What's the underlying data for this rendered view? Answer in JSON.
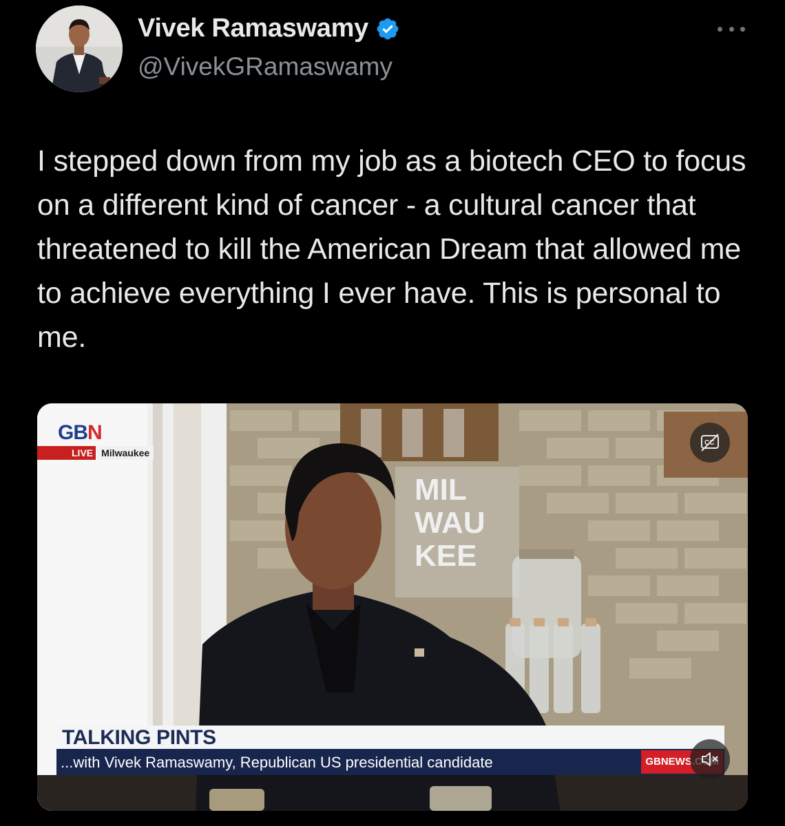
{
  "author": {
    "name": "Vivek Ramaswamy",
    "handle": "@VivekGRamaswamy",
    "verified": true
  },
  "tweet": {
    "text": "I stepped down from my job as a biotech CEO to focus on a different kind of cancer - a cultural cancer that threatened to kill the American Dream that allowed me to achieve everything I ever have. This is personal to me."
  },
  "video": {
    "channel_logo": "GBN",
    "live_label": "LIVE",
    "location": "Milwaukee",
    "sign_text": [
      "MIL",
      "WAU",
      "KEE"
    ],
    "lower_third_title": "TALKING PINTS",
    "lower_third_subtitle": "...with Vivek Ramaswamy, Republican US presidential candidate",
    "watermark": "GBNEWS.COM",
    "icons": {
      "captions": "closed-captions-icon",
      "mute": "speaker-muted-icon"
    }
  },
  "colors": {
    "background": "#000000",
    "text": "#e7e9ea",
    "secondary_text": "#8b9197",
    "verified_blue": "#1d9bf0",
    "gbn_red": "#c8201f",
    "gbn_navy": "#18264e"
  }
}
